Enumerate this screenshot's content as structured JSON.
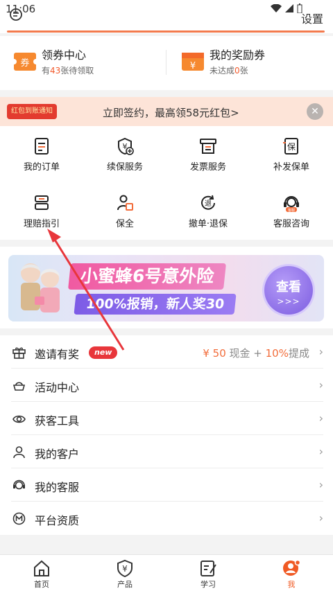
{
  "status": {
    "time": "11:06"
  },
  "header": {
    "settings_label": "设置"
  },
  "coupons": [
    {
      "title": "领券中心",
      "sub_prefix": "有",
      "sub_highlight": "43",
      "sub_suffix": "张待领取",
      "icon": "coupon-ticket-icon"
    },
    {
      "title": "我的奖励券",
      "sub_prefix": "未达成",
      "sub_highlight": "0",
      "sub_suffix": "张",
      "icon": "reward-voucher-icon"
    }
  ],
  "signbar": {
    "tag": "红包到账通知",
    "text": "立即签约，最高领58元红包>"
  },
  "grid": [
    {
      "label": "我的订单",
      "icon": "order-icon"
    },
    {
      "label": "续保服务",
      "icon": "renewal-icon"
    },
    {
      "label": "发票服务",
      "icon": "invoice-icon"
    },
    {
      "label": "补发保单",
      "icon": "reissue-policy-icon"
    },
    {
      "label": "理赔指引",
      "icon": "claim-guide-icon"
    },
    {
      "label": "保全",
      "icon": "preservation-icon"
    },
    {
      "label": "撤单·退保",
      "icon": "cancel-refund-icon"
    },
    {
      "label": "客服咨询",
      "icon": "customer-service-icon"
    }
  ],
  "grid_service_badge": "客服",
  "grid_cancel_glyph": "退",
  "grid_reissue_glyph": "保",
  "grid_renew_glyph": "¥",
  "ad": {
    "headline": "小蜜蜂6号意外险",
    "subline": "100%报销，新人奖30",
    "cta": "查看",
    "cta_arrows": ">>>"
  },
  "list": [
    {
      "label": "邀请有奖",
      "icon": "gift-icon",
      "badge": "new",
      "reward_prefix": "¥ 50",
      "reward_mid": " 现金 + ",
      "reward_pct": "10%",
      "reward_suffix": "提成"
    },
    {
      "label": "活动中心",
      "icon": "activity-icon"
    },
    {
      "label": "获客工具",
      "icon": "acquisition-tool-icon"
    },
    {
      "label": "我的客户",
      "icon": "customers-icon"
    },
    {
      "label": "我的客服",
      "icon": "service-agent-icon"
    },
    {
      "label": "平台资质",
      "icon": "qualification-icon"
    }
  ],
  "tabs": [
    {
      "label": "首页",
      "icon": "home-icon"
    },
    {
      "label": "产品",
      "icon": "product-icon"
    },
    {
      "label": "学习",
      "icon": "study-icon"
    },
    {
      "label": "我",
      "icon": "me-icon"
    }
  ],
  "tab_product_glyph": "¥",
  "colors": {
    "accent": "#f26c3a",
    "badge_red": "#e8363b",
    "active_tab": "#f05a24"
  }
}
